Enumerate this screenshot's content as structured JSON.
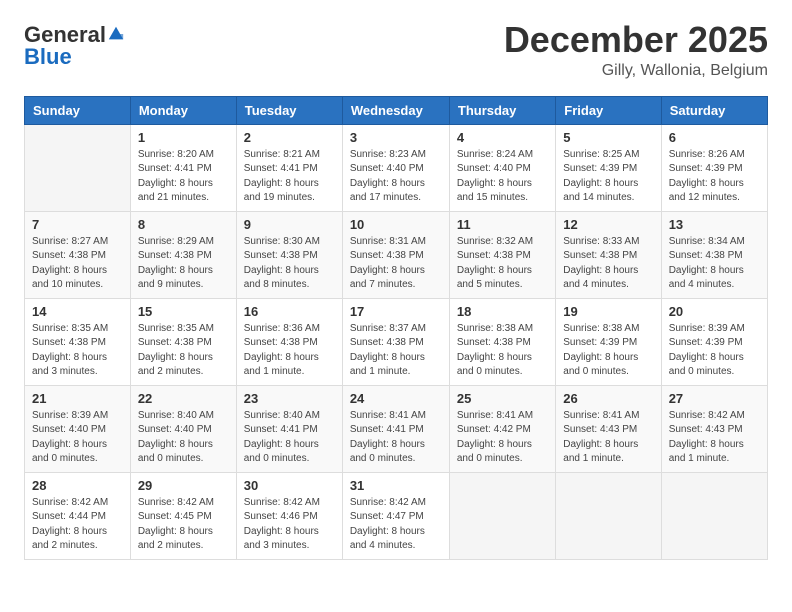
{
  "header": {
    "logo_general": "General",
    "logo_blue": "Blue",
    "month_year": "December 2025",
    "location": "Gilly, Wallonia, Belgium"
  },
  "days_of_week": [
    "Sunday",
    "Monday",
    "Tuesday",
    "Wednesday",
    "Thursday",
    "Friday",
    "Saturday"
  ],
  "weeks": [
    [
      {
        "day": "",
        "sunrise": "",
        "sunset": "",
        "daylight": ""
      },
      {
        "day": "1",
        "sunrise": "Sunrise: 8:20 AM",
        "sunset": "Sunset: 4:41 PM",
        "daylight": "Daylight: 8 hours and 21 minutes."
      },
      {
        "day": "2",
        "sunrise": "Sunrise: 8:21 AM",
        "sunset": "Sunset: 4:41 PM",
        "daylight": "Daylight: 8 hours and 19 minutes."
      },
      {
        "day": "3",
        "sunrise": "Sunrise: 8:23 AM",
        "sunset": "Sunset: 4:40 PM",
        "daylight": "Daylight: 8 hours and 17 minutes."
      },
      {
        "day": "4",
        "sunrise": "Sunrise: 8:24 AM",
        "sunset": "Sunset: 4:40 PM",
        "daylight": "Daylight: 8 hours and 15 minutes."
      },
      {
        "day": "5",
        "sunrise": "Sunrise: 8:25 AM",
        "sunset": "Sunset: 4:39 PM",
        "daylight": "Daylight: 8 hours and 14 minutes."
      },
      {
        "day": "6",
        "sunrise": "Sunrise: 8:26 AM",
        "sunset": "Sunset: 4:39 PM",
        "daylight": "Daylight: 8 hours and 12 minutes."
      }
    ],
    [
      {
        "day": "7",
        "sunrise": "Sunrise: 8:27 AM",
        "sunset": "Sunset: 4:38 PM",
        "daylight": "Daylight: 8 hours and 10 minutes."
      },
      {
        "day": "8",
        "sunrise": "Sunrise: 8:29 AM",
        "sunset": "Sunset: 4:38 PM",
        "daylight": "Daylight: 8 hours and 9 minutes."
      },
      {
        "day": "9",
        "sunrise": "Sunrise: 8:30 AM",
        "sunset": "Sunset: 4:38 PM",
        "daylight": "Daylight: 8 hours and 8 minutes."
      },
      {
        "day": "10",
        "sunrise": "Sunrise: 8:31 AM",
        "sunset": "Sunset: 4:38 PM",
        "daylight": "Daylight: 8 hours and 7 minutes."
      },
      {
        "day": "11",
        "sunrise": "Sunrise: 8:32 AM",
        "sunset": "Sunset: 4:38 PM",
        "daylight": "Daylight: 8 hours and 5 minutes."
      },
      {
        "day": "12",
        "sunrise": "Sunrise: 8:33 AM",
        "sunset": "Sunset: 4:38 PM",
        "daylight": "Daylight: 8 hours and 4 minutes."
      },
      {
        "day": "13",
        "sunrise": "Sunrise: 8:34 AM",
        "sunset": "Sunset: 4:38 PM",
        "daylight": "Daylight: 8 hours and 4 minutes."
      }
    ],
    [
      {
        "day": "14",
        "sunrise": "Sunrise: 8:35 AM",
        "sunset": "Sunset: 4:38 PM",
        "daylight": "Daylight: 8 hours and 3 minutes."
      },
      {
        "day": "15",
        "sunrise": "Sunrise: 8:35 AM",
        "sunset": "Sunset: 4:38 PM",
        "daylight": "Daylight: 8 hours and 2 minutes."
      },
      {
        "day": "16",
        "sunrise": "Sunrise: 8:36 AM",
        "sunset": "Sunset: 4:38 PM",
        "daylight": "Daylight: 8 hours and 1 minute."
      },
      {
        "day": "17",
        "sunrise": "Sunrise: 8:37 AM",
        "sunset": "Sunset: 4:38 PM",
        "daylight": "Daylight: 8 hours and 1 minute."
      },
      {
        "day": "18",
        "sunrise": "Sunrise: 8:38 AM",
        "sunset": "Sunset: 4:38 PM",
        "daylight": "Daylight: 8 hours and 0 minutes."
      },
      {
        "day": "19",
        "sunrise": "Sunrise: 8:38 AM",
        "sunset": "Sunset: 4:39 PM",
        "daylight": "Daylight: 8 hours and 0 minutes."
      },
      {
        "day": "20",
        "sunrise": "Sunrise: 8:39 AM",
        "sunset": "Sunset: 4:39 PM",
        "daylight": "Daylight: 8 hours and 0 minutes."
      }
    ],
    [
      {
        "day": "21",
        "sunrise": "Sunrise: 8:39 AM",
        "sunset": "Sunset: 4:40 PM",
        "daylight": "Daylight: 8 hours and 0 minutes."
      },
      {
        "day": "22",
        "sunrise": "Sunrise: 8:40 AM",
        "sunset": "Sunset: 4:40 PM",
        "daylight": "Daylight: 8 hours and 0 minutes."
      },
      {
        "day": "23",
        "sunrise": "Sunrise: 8:40 AM",
        "sunset": "Sunset: 4:41 PM",
        "daylight": "Daylight: 8 hours and 0 minutes."
      },
      {
        "day": "24",
        "sunrise": "Sunrise: 8:41 AM",
        "sunset": "Sunset: 4:41 PM",
        "daylight": "Daylight: 8 hours and 0 minutes."
      },
      {
        "day": "25",
        "sunrise": "Sunrise: 8:41 AM",
        "sunset": "Sunset: 4:42 PM",
        "daylight": "Daylight: 8 hours and 0 minutes."
      },
      {
        "day": "26",
        "sunrise": "Sunrise: 8:41 AM",
        "sunset": "Sunset: 4:43 PM",
        "daylight": "Daylight: 8 hours and 1 minute."
      },
      {
        "day": "27",
        "sunrise": "Sunrise: 8:42 AM",
        "sunset": "Sunset: 4:43 PM",
        "daylight": "Daylight: 8 hours and 1 minute."
      }
    ],
    [
      {
        "day": "28",
        "sunrise": "Sunrise: 8:42 AM",
        "sunset": "Sunset: 4:44 PM",
        "daylight": "Daylight: 8 hours and 2 minutes."
      },
      {
        "day": "29",
        "sunrise": "Sunrise: 8:42 AM",
        "sunset": "Sunset: 4:45 PM",
        "daylight": "Daylight: 8 hours and 2 minutes."
      },
      {
        "day": "30",
        "sunrise": "Sunrise: 8:42 AM",
        "sunset": "Sunset: 4:46 PM",
        "daylight": "Daylight: 8 hours and 3 minutes."
      },
      {
        "day": "31",
        "sunrise": "Sunrise: 8:42 AM",
        "sunset": "Sunset: 4:47 PM",
        "daylight": "Daylight: 8 hours and 4 minutes."
      },
      {
        "day": "",
        "sunrise": "",
        "sunset": "",
        "daylight": ""
      },
      {
        "day": "",
        "sunrise": "",
        "sunset": "",
        "daylight": ""
      },
      {
        "day": "",
        "sunrise": "",
        "sunset": "",
        "daylight": ""
      }
    ]
  ]
}
